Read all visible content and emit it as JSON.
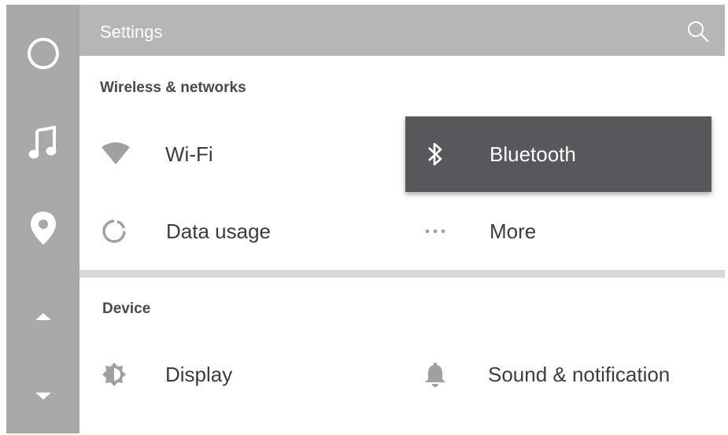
{
  "header": {
    "title": "Settings",
    "search_icon": "search-icon"
  },
  "rail": {
    "buttons": [
      {
        "name": "home-circle-icon"
      },
      {
        "name": "music-note-icon"
      },
      {
        "name": "location-pin-icon"
      },
      {
        "name": "scroll-up-icon"
      },
      {
        "name": "scroll-down-icon"
      }
    ]
  },
  "sections": [
    {
      "title": "Wireless & networks",
      "items": [
        {
          "label": "Wi-Fi",
          "icon": "wifi-icon"
        },
        {
          "label": "Bluetooth",
          "icon": "bluetooth-icon",
          "selected": true
        },
        {
          "label": "Data usage",
          "icon": "data-usage-icon"
        },
        {
          "label": "More",
          "icon": "more-dots-icon"
        }
      ]
    },
    {
      "title": "Device",
      "items": [
        {
          "label": "Display",
          "icon": "brightness-icon"
        },
        {
          "label": "Sound & notification",
          "icon": "bell-icon"
        }
      ]
    }
  ],
  "colors": {
    "rail": "#a8a8a8",
    "header": "#b6b6b6",
    "selected": "#58575c",
    "icon": "#a0a0a0"
  }
}
